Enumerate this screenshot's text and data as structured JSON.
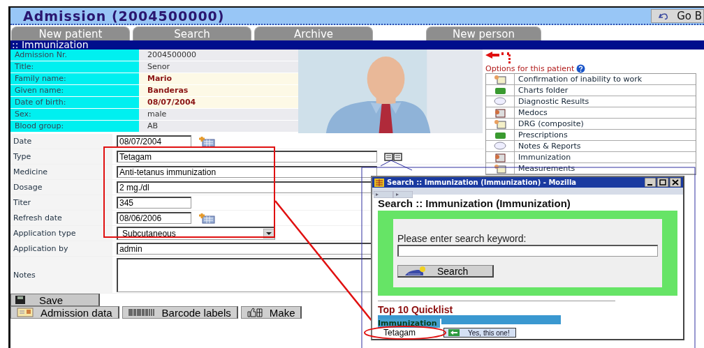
{
  "header": {
    "title": "Admission (2004500000)",
    "back_button": "Go B"
  },
  "tabs": [
    {
      "label": "New patient",
      "selected": false
    },
    {
      "label": "Search",
      "selected": false
    },
    {
      "label": "Archive",
      "selected": false
    },
    {
      "label": "New person",
      "selected": false
    }
  ],
  "section_title": ":: Immunization",
  "patient_info": [
    {
      "label": "Admission Nr.",
      "value": "2004500000",
      "highlighted": false
    },
    {
      "label": "Title:",
      "value": "Senor",
      "highlighted": false
    },
    {
      "label": "Family name:",
      "value": "Mario",
      "highlighted": true
    },
    {
      "label": "Given name:",
      "value": "Banderas",
      "highlighted": true
    },
    {
      "label": "Date of birth:",
      "value": "08/07/2004",
      "highlighted": true
    },
    {
      "label": "Sex:",
      "value": "male",
      "highlighted": false
    },
    {
      "label": "Blood group:",
      "value": "AB",
      "highlighted": false
    }
  ],
  "photo": {
    "kind": "picture"
  },
  "options": {
    "title": "Options for this patient",
    "items": [
      {
        "label": "Confirmation of inability to work"
      },
      {
        "label": "Charts folder"
      },
      {
        "label": "Diagnostic Results"
      },
      {
        "label": "Medocs"
      },
      {
        "label": "DRG (composite)"
      },
      {
        "label": "Prescriptions"
      },
      {
        "label": "Notes & Reports"
      },
      {
        "label": "Immunization"
      },
      {
        "label": "Measurements"
      }
    ]
  },
  "form": [
    {
      "label": "Date",
      "kind": "date",
      "value": "08/07/2004"
    },
    {
      "label": "Type",
      "kind": "lookup",
      "value": "Tetagam"
    },
    {
      "label": "Medicine",
      "kind": "text",
      "value": "Anti-tetanus immunization"
    },
    {
      "label": "Dosage",
      "kind": "text",
      "value": "2 mg./dl"
    },
    {
      "label": "Titer",
      "kind": "short",
      "value": "345"
    },
    {
      "label": "Refresh date",
      "kind": "date",
      "value": "08/06/2006"
    },
    {
      "label": "Application type",
      "kind": "select",
      "value": "Subcutaneous"
    },
    {
      "label": "Application by",
      "kind": "text",
      "value": "admin"
    },
    {
      "label": "Notes",
      "kind": "textarea"
    }
  ],
  "save_button": "Save",
  "bottom_buttons": [
    "Admission data",
    "Barcode labels",
    "Make"
  ],
  "popup": {
    "window_title": "Search :: Immunization (Immunization) - Mozilla",
    "heading": "Search :: Immunization (Immunization)",
    "prompt": "Please enter search keyword:",
    "search_button": "Search",
    "quicklist_title": "Top 10 Quicklist",
    "column": "Immunization",
    "rows": [
      {
        "name": "Tetagam",
        "action": "Yes, this one!"
      }
    ]
  }
}
